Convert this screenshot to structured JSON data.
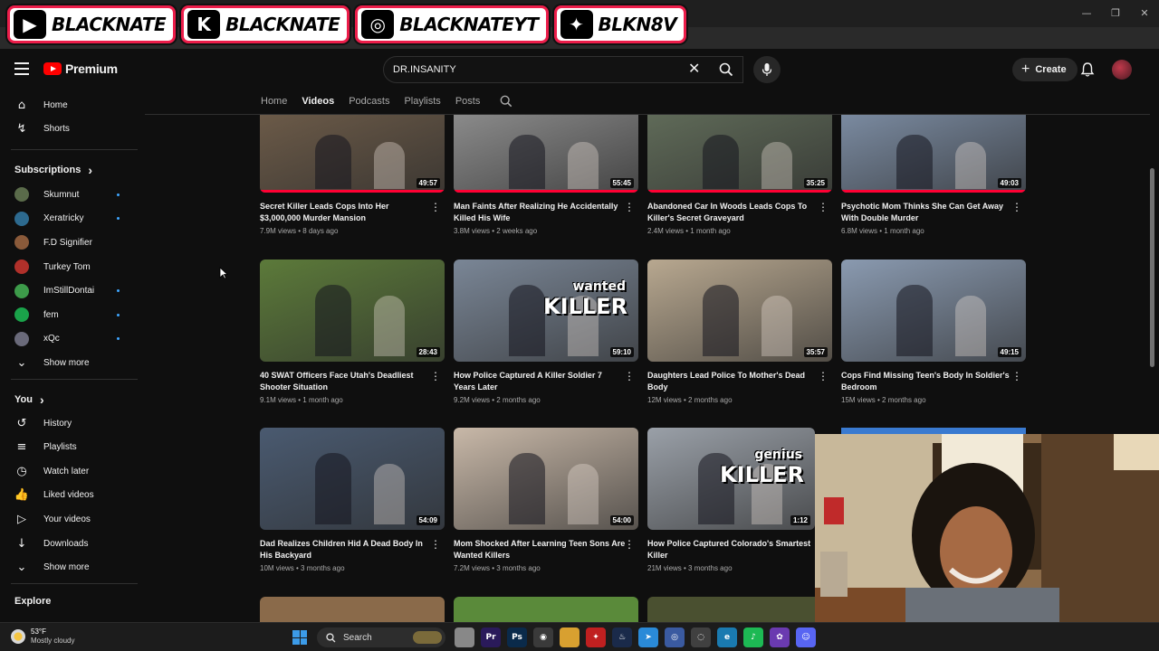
{
  "social_overlay": [
    {
      "icon": "youtube-icon",
      "glyph": "▶",
      "label": "BLACKNATE"
    },
    {
      "icon": "kick-icon",
      "glyph": "K",
      "label": "BLACKNATE"
    },
    {
      "icon": "instagram-icon",
      "glyph": "◎",
      "label": "BLACKNATEYT"
    },
    {
      "icon": "twitter-icon",
      "glyph": "✦",
      "label": "BLKN8V"
    }
  ],
  "header": {
    "logo_text": "Premium",
    "search_value": "DR.INSANITY",
    "create_label": "Create"
  },
  "sidebar": {
    "main": [
      {
        "icon": "home-icon",
        "glyph": "⌂",
        "label": "Home"
      },
      {
        "icon": "shorts-icon",
        "glyph": "↯",
        "label": "Shorts"
      }
    ],
    "subscriptions_heading": "Subscriptions",
    "channels": [
      {
        "label": "Skumnut",
        "color": "#5a6b4a",
        "dot": true
      },
      {
        "label": "Xeratricky",
        "color": "#2d6a8f",
        "dot": true
      },
      {
        "label": "F.D Signifier",
        "color": "#8a5a3a",
        "dot": false
      },
      {
        "label": "Turkey Tom",
        "color": "#b0302a",
        "dot": false
      },
      {
        "label": "ImStillDontai",
        "color": "#3d9b4a",
        "dot": true
      },
      {
        "label": "fem",
        "color": "#1aa34a",
        "dot": true
      },
      {
        "label": "xQc",
        "color": "#6a6a7a",
        "dot": true
      }
    ],
    "show_more_1": "Show more",
    "you_heading": "You",
    "you_items": [
      {
        "icon": "history-icon",
        "glyph": "↺",
        "label": "History"
      },
      {
        "icon": "playlists-icon",
        "glyph": "≡",
        "label": "Playlists"
      },
      {
        "icon": "watch-later-icon",
        "glyph": "◷",
        "label": "Watch later"
      },
      {
        "icon": "liked-videos-icon",
        "glyph": "👍",
        "label": "Liked videos"
      },
      {
        "icon": "your-videos-icon",
        "glyph": "▷",
        "label": "Your videos"
      },
      {
        "icon": "downloads-icon",
        "glyph": "↓",
        "label": "Downloads"
      }
    ],
    "show_more_2": "Show more",
    "explore_heading": "Explore"
  },
  "tabs": [
    "Home",
    "Videos",
    "Podcasts",
    "Playlists",
    "Posts"
  ],
  "active_tab": "Videos",
  "videos": [
    {
      "title": "Secret Killer Leads Cops Into Her $3,000,000 Murder Mansion",
      "views": "7.9M views",
      "age": "8 days ago",
      "duration": "49:57",
      "thumb": "#6b5a48"
    },
    {
      "title": "Man Faints After Realizing He Accidentally Killed His Wife",
      "views": "3.8M views",
      "age": "2 weeks ago",
      "duration": "55:45",
      "thumb": "#8a8a8a"
    },
    {
      "title": "Abandoned Car In Woods Leads Cops To Killer's Secret Graveyard",
      "views": "2.4M views",
      "age": "1 month ago",
      "duration": "35:25",
      "thumb": "#5f6a58"
    },
    {
      "title": "Psychotic Mom Thinks She Can Get Away With Double Murder",
      "views": "6.8M views",
      "age": "1 month ago",
      "duration": "49:03",
      "thumb": "#7a8aa0"
    },
    {
      "title": "40 SWAT Officers Face Utah's Deadliest Shooter Situation",
      "views": "9.1M views",
      "age": "1 month ago",
      "duration": "28:43",
      "thumb": "#5c7a3a"
    },
    {
      "title": "How Police Captured A Killer Soldier 7 Years Later",
      "views": "9.2M views",
      "age": "2 months ago",
      "duration": "59:10",
      "thumb": "#7a8696",
      "overlay": [
        "wanted",
        "KILLER"
      ]
    },
    {
      "title": "Daughters Lead Police To Mother's Dead Body",
      "views": "12M views",
      "age": "2 months ago",
      "duration": "35:57",
      "thumb": "#b8a890"
    },
    {
      "title": "Cops Find Missing Teen's Body In Soldier's Bedroom",
      "views": "15M views",
      "age": "2 months ago",
      "duration": "49:15",
      "thumb": "#8a9ab0"
    },
    {
      "title": "Dad Realizes Children Hid A Dead Body In His Backyard",
      "views": "10M views",
      "age": "3 months ago",
      "duration": "54:09",
      "thumb": "#4a5a70"
    },
    {
      "title": "Mom Shocked After Learning Teen Sons Are Wanted Killers",
      "views": "7.2M views",
      "age": "3 months ago",
      "duration": "54:00",
      "thumb": "#c8b8a8"
    },
    {
      "title": "How Police Captured Colorado's Smartest Killer",
      "views": "21M views",
      "age": "3 months ago",
      "duration": "1:12",
      "thumb": "#9aa0a8",
      "overlay": [
        "genius",
        "KILLER"
      ]
    }
  ],
  "taskbar": {
    "temperature": "53°F",
    "condition": "Mostly cloudy",
    "search_label": "Search",
    "apps": [
      {
        "icon": "file-explorer-icon",
        "color": "#888",
        "glyph": ""
      },
      {
        "icon": "premiere-icon",
        "color": "#2a1a5a",
        "glyph": "Pr"
      },
      {
        "icon": "photoshop-icon",
        "color": "#0a2a4a",
        "glyph": "Ps"
      },
      {
        "icon": "chrome-icon",
        "color": "#3a3a3a",
        "glyph": "◉"
      },
      {
        "icon": "folder-icon",
        "color": "#d8a030",
        "glyph": ""
      },
      {
        "icon": "app-red-icon",
        "color": "#c02020",
        "glyph": "✦"
      },
      {
        "icon": "steam-icon",
        "color": "#1a2a4a",
        "glyph": "♨"
      },
      {
        "icon": "telegram-icon",
        "color": "#2a8ad8",
        "glyph": "➤"
      },
      {
        "icon": "app-blue-icon",
        "color": "#3a5aa0",
        "glyph": "◎"
      },
      {
        "icon": "app-gray-icon",
        "color": "#404040",
        "glyph": "◌"
      },
      {
        "icon": "edge-icon",
        "color": "#1a7ab0",
        "glyph": "e"
      },
      {
        "icon": "spotify-icon",
        "color": "#1db954",
        "glyph": "♪"
      },
      {
        "icon": "app-color-icon",
        "color": "#6a3ab0",
        "glyph": "✿"
      },
      {
        "icon": "discord-icon",
        "color": "#5865f2",
        "glyph": "☺"
      }
    ]
  }
}
